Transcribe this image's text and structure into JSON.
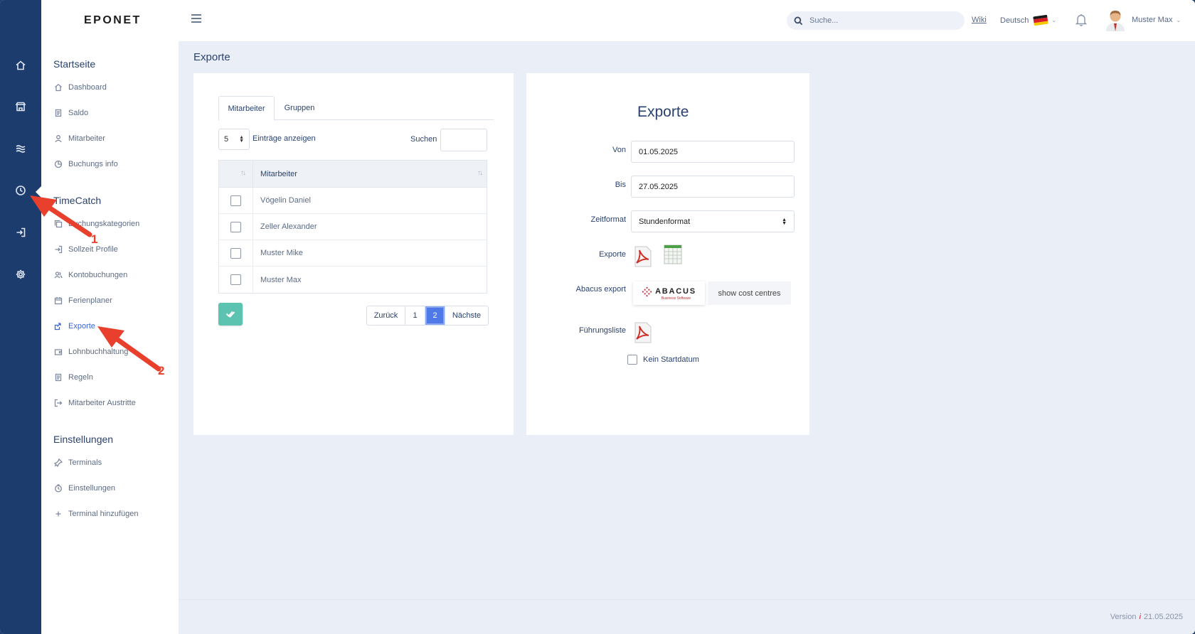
{
  "app": {
    "logo": "EPONET"
  },
  "rail": {
    "items": [
      {
        "name": "home-icon"
      },
      {
        "name": "store-icon"
      },
      {
        "name": "waves-icon"
      },
      {
        "name": "clock-icon"
      },
      {
        "name": "login-icon"
      },
      {
        "name": "gear-icon"
      }
    ]
  },
  "sidebar": {
    "sections": [
      {
        "title": "Startseite",
        "items": [
          "Dashboard",
          "Saldo",
          "Mitarbeiter",
          "Buchungs info"
        ]
      },
      {
        "title": "TimeCatch",
        "items": [
          "Buchungskategorien",
          "Sollzeit Profile",
          "Kontobuchungen",
          "Ferienplaner",
          "Exporte",
          "Lohnbuchhaltung",
          "Regeln",
          "Mitarbeiter Austritte"
        ]
      },
      {
        "title": "Einstellungen",
        "items": [
          "Terminals",
          "Einstellungen",
          "Terminal hinzufügen"
        ]
      }
    ],
    "active_item": "Exporte"
  },
  "header": {
    "search_placeholder": "Suche...",
    "wiki": "Wiki",
    "language": "Deutsch",
    "user_name": "Muster Max"
  },
  "page": {
    "title": "Exporte"
  },
  "employee_panel": {
    "tabs": [
      "Mitarbeiter",
      "Gruppen"
    ],
    "active_tab": "Mitarbeiter",
    "page_length": "5",
    "page_length_label": "Einträge anzeigen",
    "search_label": "Suchen",
    "column_header": "Mitarbeiter",
    "rows": [
      "Vögelin Daniel",
      "Zeller Alexander",
      "Muster Mike",
      "Muster Max"
    ],
    "pagination": {
      "prev": "Zurück",
      "pages": [
        "1",
        "2"
      ],
      "active_page": "2",
      "next": "Nächste"
    }
  },
  "export_panel": {
    "title": "Exporte",
    "from_label": "Von",
    "from_value": "01.05.2025",
    "to_label": "Bis",
    "to_value": "27.05.2025",
    "format_label": "Zeitformat",
    "format_value": "Stundenformat",
    "exports_label": "Exporte",
    "abacus_label": "Abacus export",
    "abacus_logo_text": "ABACUS",
    "abacus_logo_sub": "Business Software",
    "cost_centres_button": "show cost centres",
    "leadership_label": "Führungsliste",
    "no_start_label": "Kein Startdatum"
  },
  "footer": {
    "version_label": "Version",
    "version_date": "21.05.2025"
  },
  "annotations": {
    "step1": "1",
    "step2": "2"
  },
  "colors": {
    "accent": "#4e79e6",
    "rail": "#1d3c6e",
    "confirm": "#5bc3b0",
    "annotation": "#e8402c"
  }
}
